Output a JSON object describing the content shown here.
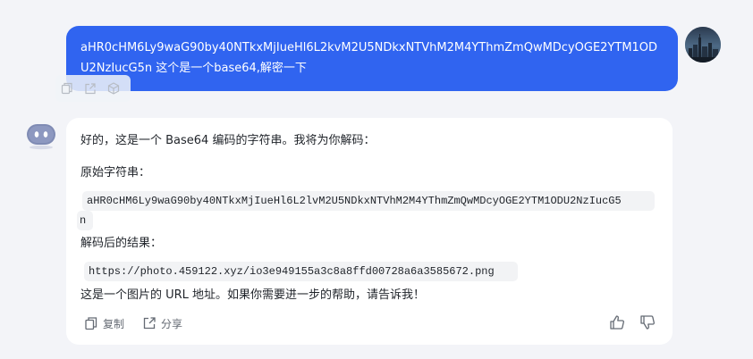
{
  "user_message": {
    "text": "aHR0cHM6Ly9waG90by40NTkxMjIueHl6L2kvM2U5NDkxNTVhM2M4YThmZmQwMDcyOGE2YTM1ODU2NzIucG5n  这个是一个base64,解密一下"
  },
  "user_actions": {
    "icons": [
      "copy-icon",
      "share-icon",
      "cube-icon"
    ]
  },
  "bot_message": {
    "intro": "好的，这是一个 Base64 编码的字符串。我将为你解码：",
    "original_label": "原始字符串：",
    "original_code_line1": "aHR0cHM6Ly9waG90by40NTkxMjIueHl6L2lvM2U5NDkxNTVhM2M4YThmZmQwMDcyOGE2YTM1ODU2NzIucG5",
    "original_code_line2": "n",
    "result_label": "解码后的结果：",
    "result_code": "https://photo.459122.xyz/io3e949155a3c8a8ffd00728a6a3585672.png",
    "closing": "这是一个图片的 URL 地址。如果你需要进一步的帮助，请告诉我！"
  },
  "footer": {
    "copy_label": "复制",
    "share_label": "分享"
  },
  "colors": {
    "accent": "#3064f0",
    "background": "#f3f4f8",
    "card": "#ffffff"
  }
}
